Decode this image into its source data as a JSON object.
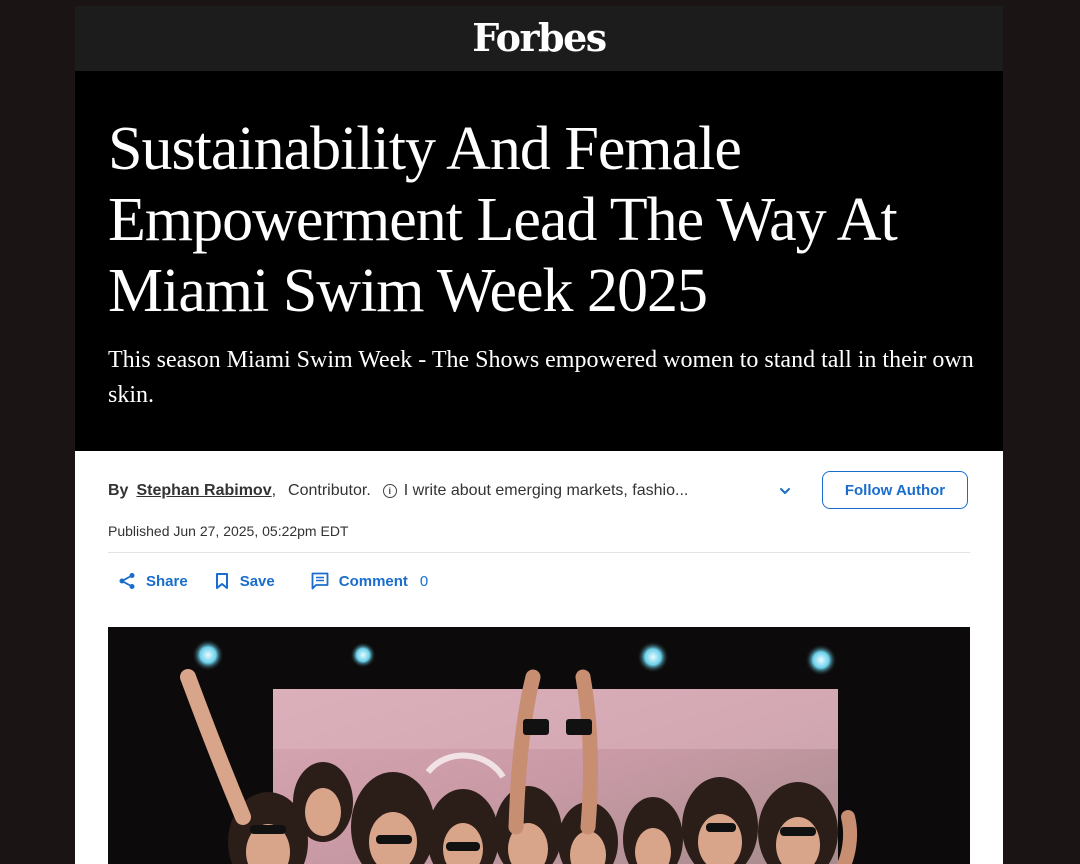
{
  "brand": {
    "logo": "Forbes"
  },
  "article": {
    "headline": "Sustainability And Female Empowerment Lead The Way At Miami Swim Week 2025",
    "dek": "This season Miami Swim Week - The Shows empowered women to stand tall in their own skin.",
    "byline_prefix": "By",
    "author": "Stephan Rabimov",
    "comma": ",",
    "role": "Contributor.",
    "bio": "I write about emerging markets, fashio...",
    "follow_label": "Follow Author",
    "published": "Published Jun 27, 2025, 05:22pm EDT"
  },
  "actions": {
    "share": "Share",
    "save": "Save",
    "comment": "Comment",
    "comment_count": "0"
  },
  "colors": {
    "accent": "#1a6dcc",
    "hero_bg": "#000000",
    "topbar_bg": "#1c1c1c"
  }
}
